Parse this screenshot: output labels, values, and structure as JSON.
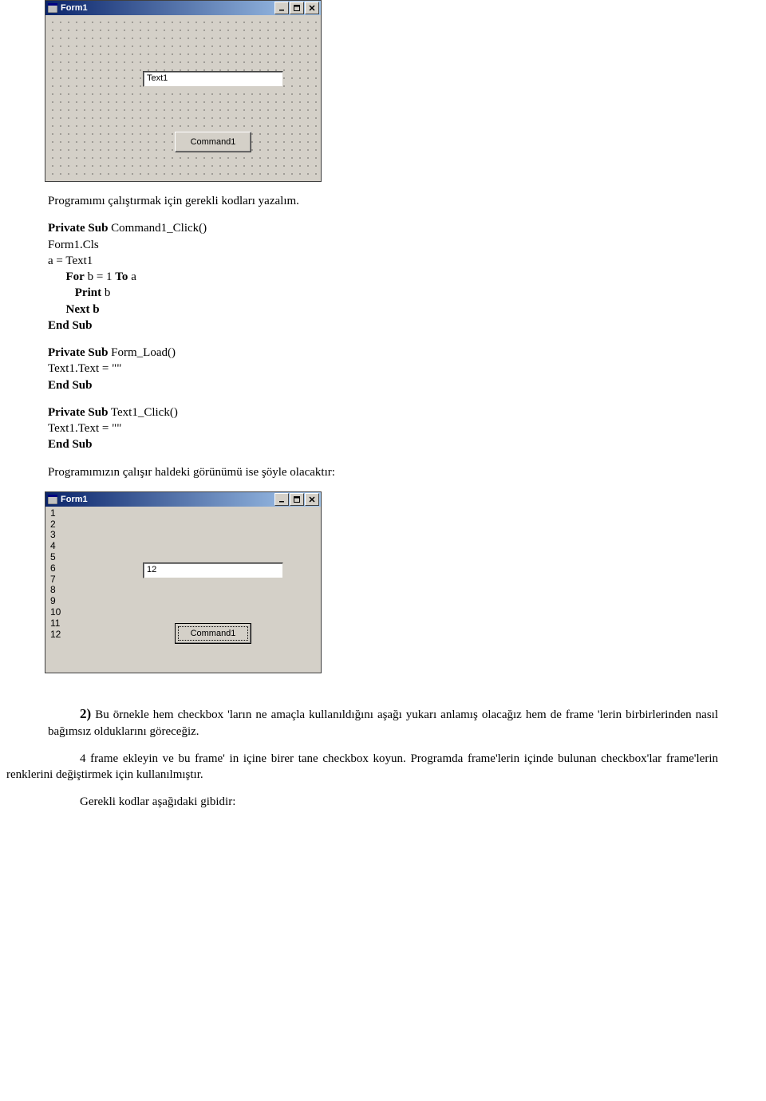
{
  "form1": {
    "title": "Form1",
    "textbox_value": "Text1",
    "button_label": "Command1"
  },
  "text": {
    "para1": "Programımı çalıştırmak için gerekli kodları yazalım.",
    "code1": {
      "l1a": "Private Sub",
      "l1b": " Command1_Click()",
      "l2": "Form1.Cls",
      "l3": "a = Text1",
      "l4a": "      For",
      "l4b": " b = 1 ",
      "l4c": "To",
      "l4d": " a",
      "l5a": "         Print",
      "l5b": " b",
      "l6": "      Next b",
      "l7": "End Sub"
    },
    "code2": {
      "l1a": "Private Sub",
      "l1b": " Form_Load()",
      "l2": "Text1.Text = \"\"",
      "l3": "End Sub"
    },
    "code3": {
      "l1a": "Private Sub",
      "l1b": " Text1_Click()",
      "l2": "Text1.Text = \"\"",
      "l3": "End Sub"
    },
    "para2": "Programımızın çalışır haldeki görünümü ise şöyle olacaktır:"
  },
  "form2": {
    "title": "Form1",
    "output_lines": [
      "1",
      "2",
      "3",
      "4",
      "5",
      "6",
      "7",
      "8",
      "9",
      "10",
      "11",
      "12"
    ],
    "textbox_value": "12",
    "button_label": "Command1"
  },
  "bottom": {
    "num": "2)",
    "p1": " Bu örnekle hem checkbox 'ların ne amaçla kullanıldığını aşağı yukarı anlamış olacağız hem de frame 'lerin birbirlerinden nasıl bağımsız olduklarını göreceğiz.",
    "p2": "4 frame ekleyin ve bu frame' in içine birer tane checkbox koyun. Programda frame'lerin içinde bulunan checkbox'lar frame'lerin renklerini değiştirmek için kullanılmıştır.",
    "p3": "Gerekli kodlar aşağıdaki gibidir:"
  }
}
